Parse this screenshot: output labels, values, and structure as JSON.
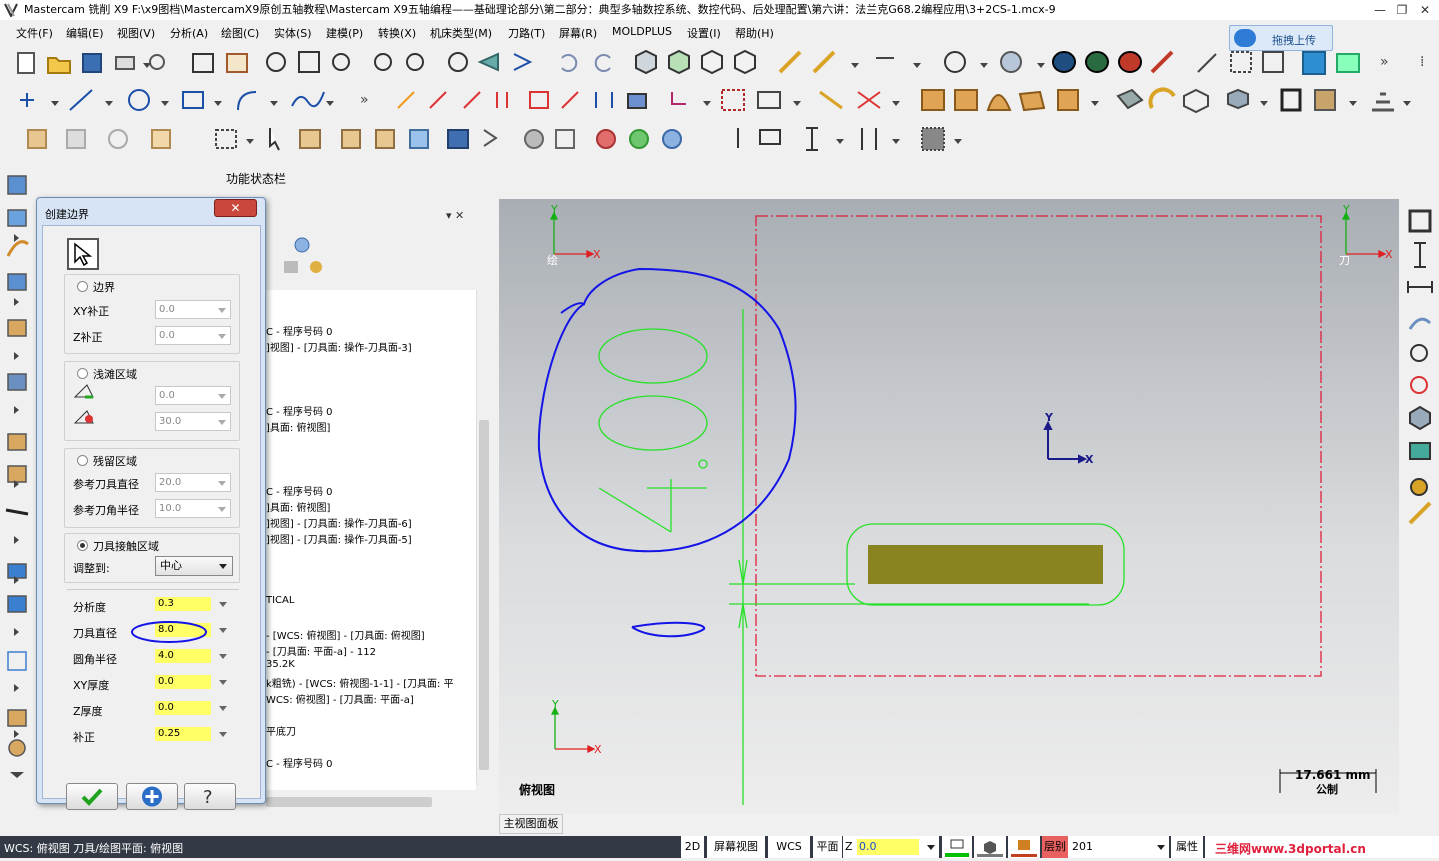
{
  "window": {
    "title": "Mastercam 铣削 X9  F:\\x9图档\\MastercamX9原创五轴教程\\Mastercam X9五轴编程——基础理论部分\\第二部分：典型多轴数控系统、数控代码、后处理配置\\第六讲：法兰克G68.2编程应用\\3+2CS-1.mcx-9",
    "minimize": "—",
    "restore": "❐",
    "close": "✕"
  },
  "menu": [
    "文件(F)",
    "编辑(E)",
    "视图(V)",
    "分析(A)",
    "绘图(C)",
    "实体(S)",
    "建模(P)",
    "转换(X)",
    "机床类型(M)",
    "刀路(T)",
    "屏幕(R)",
    "MOLDPLUS",
    "设置(I)",
    "帮助(H)"
  ],
  "upload_button": "拖拽上传",
  "function_status_bar": "功能状态栏",
  "dialog": {
    "title": "创建边界",
    "close": "✕",
    "sections": {
      "boundary": {
        "label": "边界",
        "xy_offset_label": "XY补正",
        "xy_offset": "0.0",
        "z_offset_label": "Z补正",
        "z_offset": "0.0"
      },
      "shallow": {
        "label": "浅滩区域",
        "min": "0.0",
        "max": "30.0"
      },
      "rest": {
        "label": "残留区域",
        "ref_tool_dia_label": "参考刀具直径",
        "ref_tool_dia": "20.0",
        "ref_corner_radius_label": "参考刀角半径",
        "ref_corner_radius": "10.0"
      },
      "contact": {
        "label": "刀具接触区域",
        "adjust_label": "调整到:",
        "adjust_value": "中心"
      }
    },
    "params": [
      {
        "label": "分析度",
        "value": "0.3"
      },
      {
        "label": "刀具直径",
        "value": "8.0"
      },
      {
        "label": "圆角半径",
        "value": "4.0"
      },
      {
        "label": "XY厚度",
        "value": "0.0"
      },
      {
        "label": "Z厚度",
        "value": "0.0"
      },
      {
        "label": "补正",
        "value": "0.25"
      }
    ],
    "buttons": {
      "ok": "✔",
      "add": "+",
      "help": "?"
    }
  },
  "panel": {
    "lines": [
      "C - 程序号码 0",
      "]视图] - [刀具面: 操作-刀具面-3]",
      "C - 程序号码 0",
      "]具面: 俯视图]",
      "C - 程序号码 0",
      "]具面: 俯视图]",
      "]视图] - [刀具面: 操作-刀具面-6]",
      "]视图] - [刀具面: 操作-刀具面-5]",
      "TICAL",
      "- [WCS: 俯视图] - [刀具面: 俯视图]",
      "- [刀具面: 平面-a] - 112",
      "35.2K",
      "k粗铣) - [WCS: 俯视图-1-1] - [刀具面: 平",
      "WCS: 俯视图] - [刀具面: 平面-a]",
      "平底刀",
      "C - 程序号码 0"
    ],
    "pin": "▾ ✕"
  },
  "viewport": {
    "gview_label_left": "绘",
    "gview_label_right": "刀",
    "axis_x": "X",
    "axis_y": "Y",
    "view_name": "俯视图",
    "scale_value": "17.661 mm",
    "scale_unit": "公制",
    "annotation_text": "4.00",
    "tab": "主视图面板"
  },
  "status": {
    "left": "WCS: 俯视图  刀具/绘图平面: 俯视图",
    "mode_2d": "2D",
    "screen_view": "屏幕视图",
    "wcs": "WCS",
    "plane": "平面",
    "z_label": "Z",
    "z_value": "0.0",
    "layer_label": "层别",
    "layer_value": "201",
    "attributes": "属性",
    "watermark": "三维网www.3dportal.cn"
  },
  "colors": {
    "green_geometry": "#28e028",
    "blue_scribble": "#1414e6",
    "red_boundary": "#e0203c",
    "surface_fill": "#8a8420",
    "highlight_yellow": "#ffff66"
  }
}
